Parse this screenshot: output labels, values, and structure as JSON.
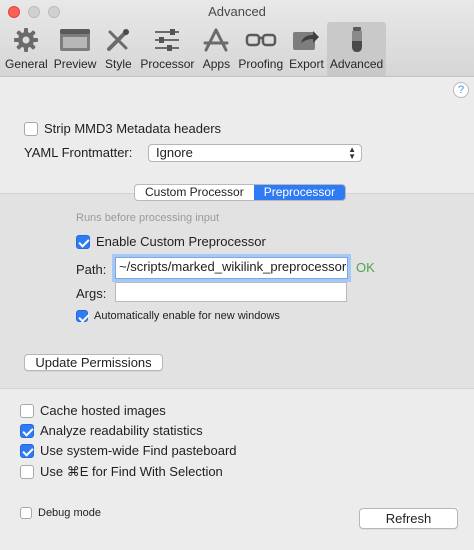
{
  "window": {
    "title": "Advanced"
  },
  "toolbar": {
    "tabs": [
      {
        "label": "General",
        "icon": "gear-icon"
      },
      {
        "label": "Preview",
        "icon": "window-icon"
      },
      {
        "label": "Style",
        "icon": "brush-icon"
      },
      {
        "label": "Processor",
        "icon": "sliders-icon"
      },
      {
        "label": "Apps",
        "icon": "app-store-icon"
      },
      {
        "label": "Proofing",
        "icon": "glasses-icon"
      },
      {
        "label": "Export",
        "icon": "export-icon"
      },
      {
        "label": "Advanced",
        "icon": "potion-icon"
      }
    ],
    "active": "Advanced"
  },
  "help": {
    "label": "?"
  },
  "metadata": {
    "strip_label": "Strip MMD3 Metadata headers",
    "strip_checked": false,
    "yaml_label": "YAML Frontmatter:",
    "yaml_value": "Ignore"
  },
  "processor": {
    "segments": [
      "Custom Processor",
      "Preprocessor"
    ],
    "selected": "Preprocessor",
    "hint": "Runs before processing input",
    "enable_label": "Enable Custom Preprocessor",
    "enable_checked": true,
    "path_label": "Path:",
    "path_value": "~/scripts/marked_wikilink_preprocessor",
    "path_status": "OK",
    "args_label": "Args:",
    "args_value": "",
    "auto_label": "Automatically enable for new windows",
    "auto_checked": true,
    "permissions_button": "Update Permissions"
  },
  "options": [
    {
      "label": "Cache hosted images",
      "checked": false
    },
    {
      "label": "Analyze readability statistics",
      "checked": true
    },
    {
      "label": "Use system-wide Find pasteboard",
      "checked": true
    },
    {
      "label": "Use ⌘E for Find With Selection",
      "checked": false
    }
  ],
  "footer": {
    "debug_label": "Debug mode",
    "debug_checked": false,
    "refresh_button": "Refresh"
  },
  "colors": {
    "accent": "#2f7bf5",
    "ok": "#4ea64e",
    "close": "#fe5f57"
  }
}
